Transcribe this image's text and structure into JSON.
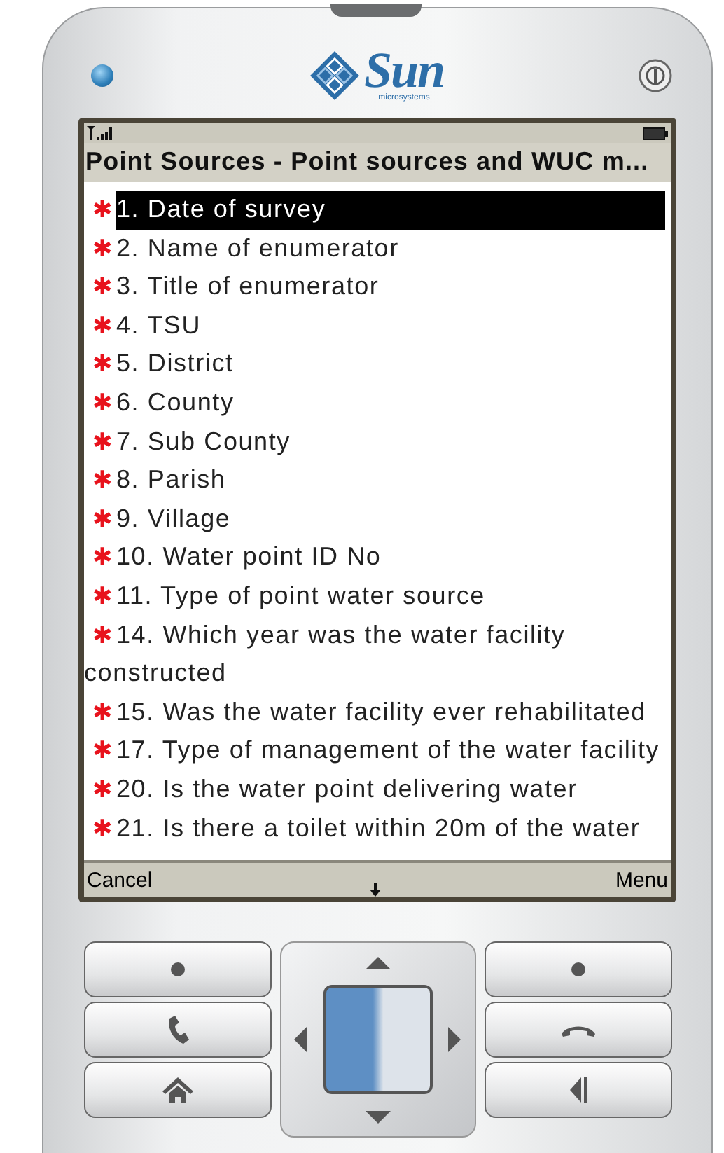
{
  "logo": {
    "brand": "Sun",
    "tagline": "microsystems"
  },
  "title": "Point Sources - Point sources and WUC m...",
  "items": [
    {
      "text": "1. Date of survey",
      "required": true,
      "selected": true
    },
    {
      "text": "2. Name of enumerator",
      "required": true,
      "selected": false
    },
    {
      "text": "3. Title of enumerator",
      "required": true,
      "selected": false
    },
    {
      "text": "4. TSU",
      "required": true,
      "selected": false
    },
    {
      "text": "5. District",
      "required": true,
      "selected": false
    },
    {
      "text": "6. County",
      "required": true,
      "selected": false
    },
    {
      "text": "7. Sub County",
      "required": true,
      "selected": false
    },
    {
      "text": "8. Parish",
      "required": true,
      "selected": false
    },
    {
      "text": "9. Village",
      "required": true,
      "selected": false
    },
    {
      "text": "10. Water point ID No",
      "required": true,
      "selected": false
    },
    {
      "text": "11. Type of point water source",
      "required": true,
      "selected": false
    },
    {
      "text": "14. Which year was the water facility constructed",
      "required": true,
      "selected": false
    },
    {
      "text": "15. Was the water facility ever rehabilitated",
      "required": true,
      "selected": false
    },
    {
      "text": "17. Type of management of the water facility",
      "required": true,
      "selected": false
    },
    {
      "text": "20. Is the water point delivering water",
      "required": true,
      "selected": false
    },
    {
      "text": "21. Is there a toilet within 20m of the water",
      "required": true,
      "selected": false
    }
  ],
  "softkeys": {
    "left": "Cancel",
    "right": "Menu"
  },
  "required_mark": "✱"
}
